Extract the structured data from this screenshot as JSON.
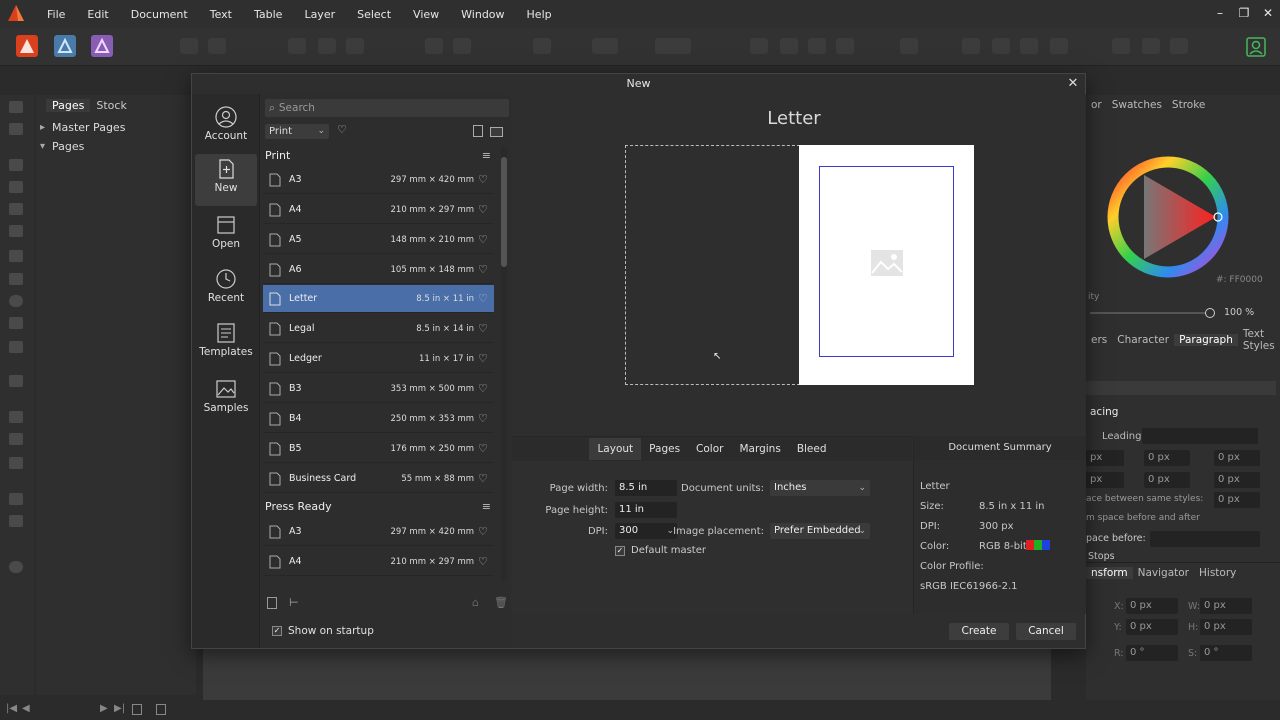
{
  "menubar": {
    "items": [
      "File",
      "Edit",
      "Document",
      "Text",
      "Table",
      "Layer",
      "Select",
      "View",
      "Window",
      "Help"
    ],
    "window_controls": [
      "–",
      "❐",
      "✕"
    ]
  },
  "pages_panel": {
    "tabs": [
      "Pages",
      "Stock"
    ],
    "sections": [
      "Master Pages",
      "Pages"
    ]
  },
  "right_panel": {
    "top_tabs": [
      "or",
      "Swatches",
      "Stroke"
    ],
    "hex_value": "#: FF0000",
    "opacity_label": "ity",
    "opacity_value": "100 %",
    "para_tabs": [
      "ers",
      "Character",
      "Paragraph",
      "Text Styles"
    ],
    "spacing_label": "acing",
    "leading_label": "Leading:",
    "px_values": [
      "px",
      "0 px",
      "0 px",
      "px",
      "0 px",
      "0 px"
    ],
    "space_between_label": "ace between same styles:",
    "space_between_value": "0 px",
    "space_before_after": "m space before and after",
    "space_before_label": "pace before:",
    "stops_label": "Stops",
    "transform_tabs": [
      "nsform",
      "Navigator",
      "History"
    ],
    "transform_fields": [
      {
        "label": "X:",
        "value": "0 px"
      },
      {
        "label": "W:",
        "value": "0 px"
      },
      {
        "label": "Y:",
        "value": "0 px"
      },
      {
        "label": "H:",
        "value": "0 px"
      },
      {
        "label": "R:",
        "value": "0 °"
      },
      {
        "label": "S:",
        "value": "0 °"
      }
    ]
  },
  "dialog": {
    "title": "New",
    "nav": [
      {
        "label": "Account",
        "icon": "account-icon"
      },
      {
        "label": "New",
        "icon": "new-document-icon"
      },
      {
        "label": "Open",
        "icon": "open-folder-icon"
      },
      {
        "label": "Recent",
        "icon": "recent-clock-icon"
      },
      {
        "label": "Templates",
        "icon": "templates-icon"
      },
      {
        "label": "Samples",
        "icon": "samples-icon"
      }
    ],
    "search_placeholder": "Search",
    "category": "Print",
    "sections": [
      {
        "title": "Print",
        "presets": [
          {
            "name": "A3",
            "size": "297 mm × 420 mm"
          },
          {
            "name": "A4",
            "size": "210 mm × 297 mm"
          },
          {
            "name": "A5",
            "size": "148 mm × 210 mm"
          },
          {
            "name": "A6",
            "size": "105 mm × 148 mm"
          },
          {
            "name": "Letter",
            "size": "8.5 in × 11 in"
          },
          {
            "name": "Legal",
            "size": "8.5 in × 14 in"
          },
          {
            "name": "Ledger",
            "size": "11 in × 17 in"
          },
          {
            "name": "B3",
            "size": "353 mm × 500 mm"
          },
          {
            "name": "B4",
            "size": "250 mm × 353 mm"
          },
          {
            "name": "B5",
            "size": "176 mm × 250 mm"
          },
          {
            "name": "Business Card",
            "size": "55 mm × 88 mm"
          }
        ]
      },
      {
        "title": "Press Ready",
        "presets": [
          {
            "name": "A3",
            "size": "297 mm × 420 mm"
          },
          {
            "name": "A4",
            "size": "210 mm × 297 mm"
          }
        ]
      }
    ],
    "show_on_startup": "Show on startup",
    "preview_title": "Letter",
    "settings_tabs": [
      "Layout",
      "Pages",
      "Color",
      "Margins",
      "Bleed"
    ],
    "fields": {
      "page_width_label": "Page width:",
      "page_width": "8.5 in",
      "page_height_label": "Page height:",
      "page_height": "11 in",
      "dpi_label": "DPI:",
      "dpi": "300",
      "units_label": "Document units:",
      "units": "Inches",
      "placement_label": "Image placement:",
      "placement": "Prefer Embedded",
      "default_master": "Default master"
    },
    "summary": {
      "title": "Document Summary",
      "name": "Letter",
      "size_label": "Size:",
      "size": "8.5 in  x  11 in",
      "dpi_label": "DPI:",
      "dpi": "300 px",
      "color_label": "Color:",
      "color": "RGB 8-bit",
      "profile_label": "Color Profile:",
      "profile": "sRGB IEC61966-2.1"
    },
    "buttons": {
      "create": "Create",
      "cancel": "Cancel"
    }
  },
  "colors": {
    "accent": "#4a6ea8",
    "publisher_logo": "#d9411e",
    "designer_icon": "#6aa0cf",
    "photo_icon": "#a776c9",
    "account_green": "#47b85c"
  }
}
